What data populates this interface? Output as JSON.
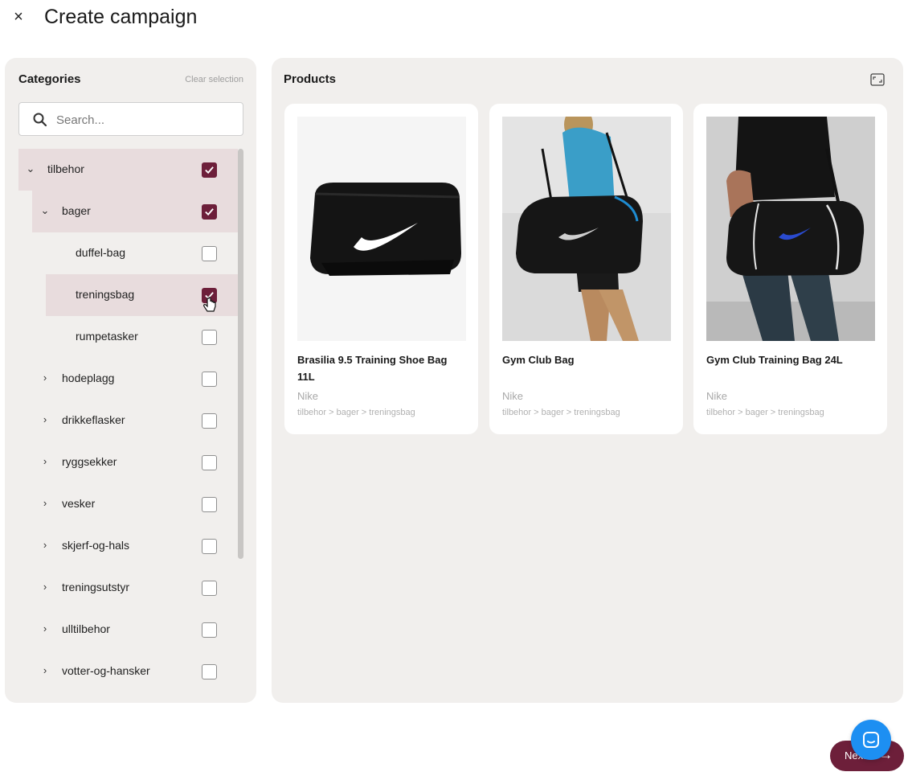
{
  "header": {
    "close_glyph": "×",
    "title": "Create campaign"
  },
  "categories": {
    "title": "Categories",
    "clear_label": "Clear selection",
    "search_placeholder": "Search...",
    "items": [
      {
        "label": "tilbehor",
        "expanded": true,
        "checked": true,
        "level": 0
      },
      {
        "label": "bager",
        "expanded": true,
        "checked": true,
        "level": 1
      },
      {
        "label": "duffel-bag",
        "checked": false,
        "level": 2
      },
      {
        "label": "treningsbag",
        "checked": true,
        "level": 2
      },
      {
        "label": "rumpetasker",
        "checked": false,
        "level": 2
      },
      {
        "label": "hodeplagg",
        "expanded": false,
        "checked": false,
        "level": 1
      },
      {
        "label": "drikkeflasker",
        "expanded": false,
        "checked": false,
        "level": 1
      },
      {
        "label": "ryggsekker",
        "expanded": false,
        "checked": false,
        "level": 1
      },
      {
        "label": "vesker",
        "expanded": false,
        "checked": false,
        "level": 1
      },
      {
        "label": "skjerf-og-hals",
        "expanded": false,
        "checked": false,
        "level": 1
      },
      {
        "label": "treningsutstyr",
        "expanded": false,
        "checked": false,
        "level": 1
      },
      {
        "label": "ulltilbehor",
        "expanded": false,
        "checked": false,
        "level": 1
      },
      {
        "label": "votter-og-hansker",
        "expanded": false,
        "checked": false,
        "level": 1
      }
    ]
  },
  "products": {
    "title": "Products",
    "expand_icon": "expand-icon",
    "items": [
      {
        "name": "Brasilia 9.5 Training Shoe Bag 11L",
        "brand": "Nike",
        "path": "tilbehor > bager > treningsbag"
      },
      {
        "name": "Gym Club Bag",
        "brand": "Nike",
        "path": "tilbehor > bager > treningsbag"
      },
      {
        "name": "Gym Club Training Bag 24L",
        "brand": "Nike",
        "path": "tilbehor > bager > treningsbag"
      }
    ]
  },
  "footer": {
    "next_label": "Next",
    "next_arrow": "→"
  },
  "colors": {
    "accent": "#6d1f3a",
    "selected_row": "#e8dcdd",
    "panel_bg": "#f1efed",
    "chat": "#1d8ff2"
  }
}
